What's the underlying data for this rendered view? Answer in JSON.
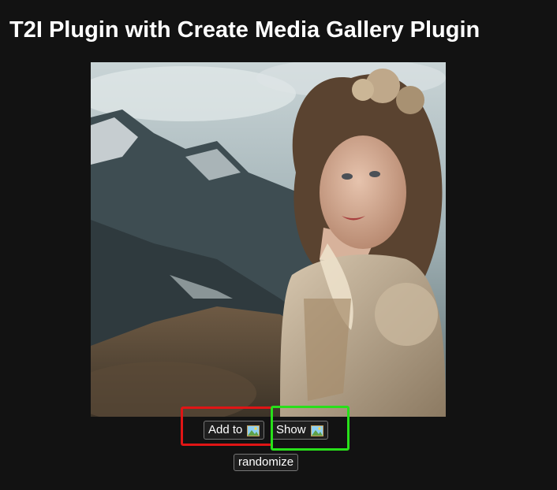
{
  "page": {
    "title": "T2I Plugin with Create Media Gallery Plugin"
  },
  "image": {
    "subject": "portrait-woman-victorian-dress-mountains"
  },
  "buttons": {
    "add_label": "Add to",
    "show_label": "Show",
    "randomize_label": "randomize",
    "gallery_icon": "framed-picture-icon"
  },
  "highlights": {
    "add_color": "#e01515",
    "show_color": "#28e01a"
  }
}
